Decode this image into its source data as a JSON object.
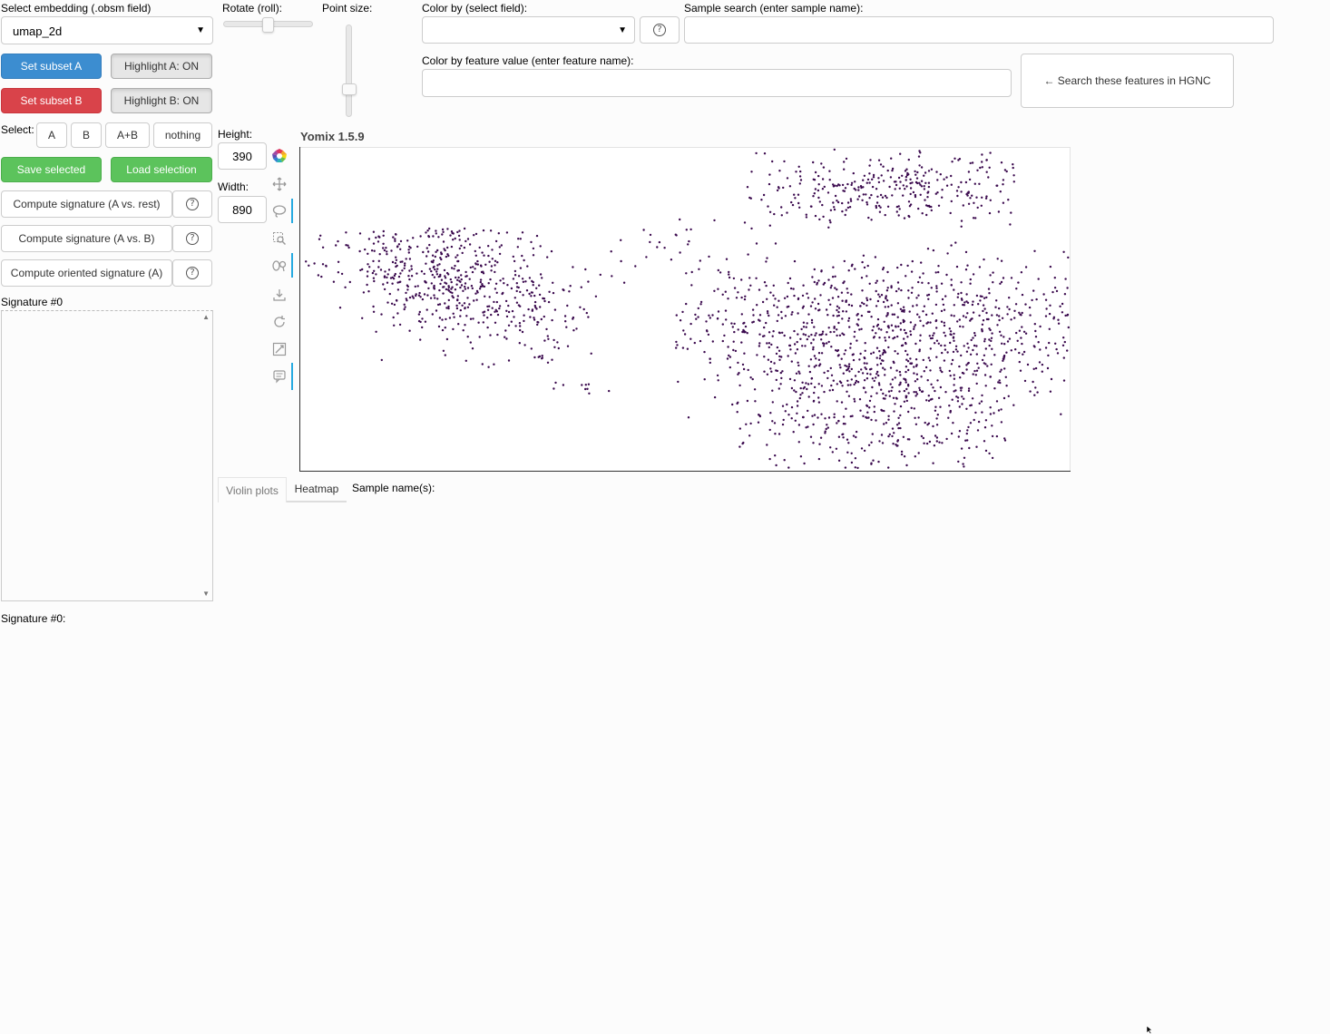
{
  "embedding": {
    "label": "Select embedding (.obsm field)",
    "value": "umap_2d"
  },
  "rotate": {
    "label": "Rotate (roll):",
    "value": 0.5
  },
  "point_size": {
    "label": "Point size:",
    "value": 0.3
  },
  "color_by_field": {
    "label": "Color by (select field):",
    "value": ""
  },
  "sample_search": {
    "label": "Sample search (enter sample name):",
    "value": ""
  },
  "color_by_feature": {
    "label": "Color by feature value (enter feature name):",
    "value": ""
  },
  "hgnc_button": "← Search these features in HGNC",
  "subset": {
    "set_a": "Set subset A",
    "highlight_a": "Highlight A: ON",
    "set_b": "Set subset B",
    "highlight_b": "Highlight B: ON"
  },
  "select": {
    "label": "Select:",
    "options": [
      "A",
      "B",
      "A+B",
      "nothing"
    ]
  },
  "save_selected": "Save selected",
  "load_selection": "Load selection",
  "signatures": {
    "compute_a_rest": "Compute signature (A vs. rest)",
    "compute_a_b": "Compute signature (A vs. B)",
    "compute_oriented": "Compute oriented signature (A)",
    "help_glyph": "?"
  },
  "signature_box_label": "Signature #0",
  "signature_footer": "Signature #0:",
  "size": {
    "height_label": "Height:",
    "height_value": "390",
    "width_label": "Width:",
    "width_value": "890"
  },
  "plot_title": "Yomix 1.5.9",
  "tabs": {
    "violin": "Violin plots",
    "heatmap": "Heatmap"
  },
  "sample_names_label": "Sample name(s):",
  "colors": {
    "point": "#3b0a4e",
    "tool_separator": "#26aae1",
    "set_a": "#3c8dd0",
    "set_b": "#d9434a",
    "save_load": "#5cc35c"
  },
  "toolbar_icons": [
    "bokeh-logo-icon",
    "pan-icon",
    "lasso-select-icon",
    "box-zoom-icon",
    "wheel-zoom-icon",
    "save-icon",
    "reset-icon",
    "hover-icon",
    "tooltip-icon"
  ]
}
